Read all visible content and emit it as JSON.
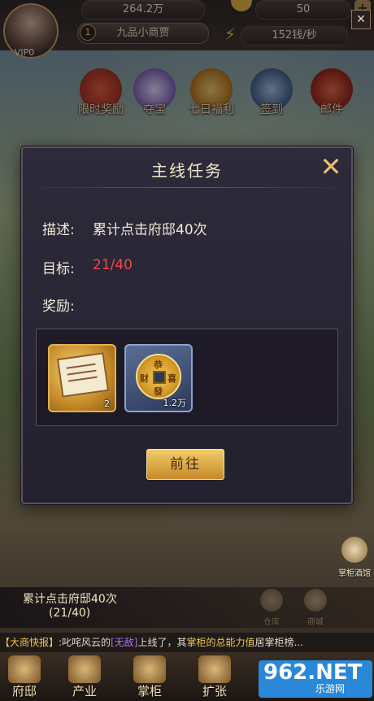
{
  "top": {
    "vip": "VIP0",
    "silver": "264.2万",
    "gold": "50",
    "rank_level": "1",
    "rank_title": "九品小商贾",
    "income_rate": "152钱/秒",
    "plus": "+"
  },
  "menu": [
    {
      "label": "限时奖励",
      "icon": "gift-chest-icon"
    },
    {
      "label": "夺宝",
      "icon": "crystal-ball-icon"
    },
    {
      "label": "七日福利",
      "icon": "treasure-basket-icon"
    },
    {
      "label": "签到",
      "icon": "scroll-icon"
    },
    {
      "label": "邮件",
      "icon": "mail-icon"
    }
  ],
  "dialog": {
    "title": "主线任务",
    "close": "✕",
    "desc_label": "描述:",
    "desc_value": "累计点击府邸40次",
    "goal_label": "目标:",
    "goal_value": "21/40",
    "reward_label": "奖励:",
    "rewards": [
      {
        "name": "book-item",
        "count": "2"
      },
      {
        "name": "copper-coin-item",
        "count": "1.2万",
        "chars": [
          "恭",
          "喜",
          "發",
          "财"
        ]
      }
    ],
    "go_button": "前往"
  },
  "quest_bar": {
    "text": "累计点击府邸40次",
    "progress": "(21/40)",
    "close": "✕"
  },
  "side_right": [
    {
      "label": "掌柜酒馆"
    },
    {
      "label": "仓库"
    },
    {
      "label": "商城"
    }
  ],
  "ticker": {
    "tag": "【大商快报】",
    "part1": ":叱咤风云的",
    "name": "[无敌]",
    "part2": "上线了，其",
    "hl": "掌柜的总能力值",
    "part3": "居掌柜榜..."
  },
  "nav": [
    {
      "label": "府邸"
    },
    {
      "label": "产业"
    },
    {
      "label": "掌柜"
    },
    {
      "label": "扩张"
    }
  ],
  "watermark": {
    "big": "962.NET",
    "small": "乐游网"
  },
  "colors": {
    "accent_gold": "#c58a28",
    "progress_red": "#f04848",
    "dialog_bg": "#2d2a3a"
  }
}
